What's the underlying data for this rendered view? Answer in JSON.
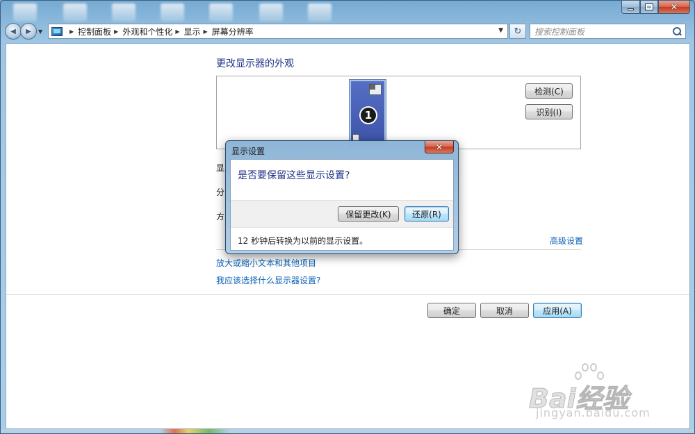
{
  "window": {
    "caption_buttons": {
      "minimize_icon": "minimize-icon",
      "maximize_icon": "maximize-icon",
      "close_glyph": "✕"
    }
  },
  "navbar": {
    "back_glyph": "◀",
    "forward_glyph": "▶",
    "breadcrumbs": [
      "控制面板",
      "外观和个性化",
      "显示",
      "屏幕分辨率"
    ],
    "search_placeholder": "搜索控制面板",
    "refresh_glyph": "↻"
  },
  "main": {
    "title": "更改显示器的外观",
    "monitor_number": "1",
    "detect_button": "检测(C)",
    "identify_button": "识别(I)",
    "row_label_1": "显",
    "row_label_2": "分",
    "row_label_3": "方",
    "advanced_link": "高级设置",
    "link_text_size": "放大或缩小文本和其他项目",
    "link_which_settings": "我应该选择什么显示器设置?",
    "ok_button": "确定",
    "cancel_button": "取消",
    "apply_button": "应用(A)"
  },
  "dialog": {
    "title": "显示设置",
    "close_glyph": "✕",
    "question": "是否要保留这些显示设置?",
    "keep_button": "保留更改(K)",
    "revert_button": "还原(R)",
    "countdown_text": "12 秒钟后转换为以前的显示设置。"
  },
  "watermark": {
    "brand": "Bai经验",
    "site": "jingyan.baidu.com"
  }
}
